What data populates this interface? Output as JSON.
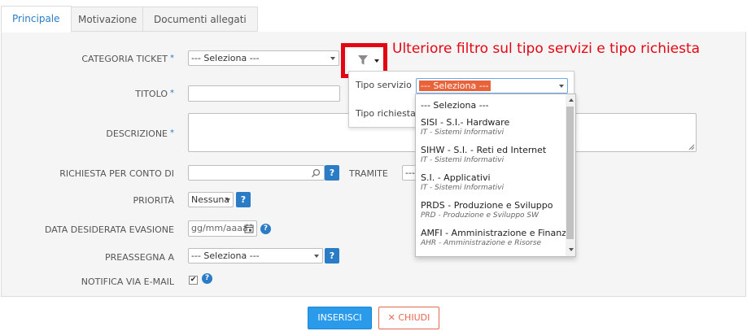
{
  "tabs": [
    {
      "label": "Principale",
      "active": true
    },
    {
      "label": "Motivazione",
      "active": false
    },
    {
      "label": "Documenti allegati",
      "active": false
    }
  ],
  "annotation": "Ulteriore filtro sul tipo servizi e tipo richiesta",
  "required_mark": "*",
  "help_label": "?",
  "form": {
    "categoria": {
      "label": "CATEGORIA TICKET",
      "value": "--- Seleziona ---"
    },
    "titolo": {
      "label": "TITOLO",
      "value": ""
    },
    "descrizione": {
      "label": "DESCRIZIONE",
      "value": ""
    },
    "richiesta": {
      "label": "RICHIESTA PER CONTO DI",
      "value": ""
    },
    "tramite": {
      "label": "TRAMITE",
      "value": "---"
    },
    "priorita": {
      "label": "PRIORITÀ",
      "value": "Nessuna"
    },
    "data": {
      "label": "DATA DESIDERATA EVASIONE",
      "placeholder": "gg/mm/aaaa"
    },
    "preassegna": {
      "label": "PREASSEGNA A",
      "value": "--- Seleziona ---"
    },
    "notifica": {
      "label": "NOTIFICA VIA E-MAIL",
      "checked": true,
      "check_glyph": "✔"
    }
  },
  "filter": {
    "tipo_servizio_label": "Tipo servizio",
    "tipo_servizio_value": "--- Seleziona ---",
    "tipo_richiesta_label": "Tipo richiesta",
    "options": [
      {
        "main": "--- Seleziona ---",
        "sub": ""
      },
      {
        "main": "SISI - S.I.- Hardware",
        "sub": "IT - Sistemi Informativi"
      },
      {
        "main": "SIHW - S.I. - Reti ed Internet",
        "sub": "IT - Sistemi Informativi"
      },
      {
        "main": "S.I. - Applicativi",
        "sub": "IT - Sistemi Informativi"
      },
      {
        "main": "PRDS - Produzione e Sviluppo",
        "sub": "PRD - Produzione e Sviluppo SW"
      },
      {
        "main": "AMFI - Amministrazione e Finanza",
        "sub": "AHR - Amministrazione e Risorse"
      }
    ]
  },
  "buttons": {
    "insert": "INSERISCI",
    "close_icon": "✕",
    "close": "CHIUDI"
  },
  "colors": {
    "accent": "#2a7cc7",
    "highlight": "#e30613",
    "selected_bg": "#e8623a",
    "button": "#2a9bea",
    "close": "#e66a52"
  }
}
